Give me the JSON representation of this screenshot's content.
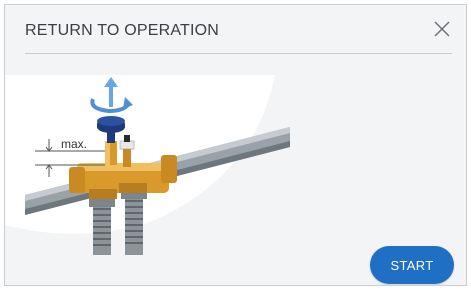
{
  "dialog": {
    "title": "RETURN TO OPERATION",
    "close_icon": "close-icon",
    "start_label": "START"
  },
  "illustration": {
    "measure_label": "max.",
    "rotate_icon": "rotate-arrow-icon"
  },
  "colors": {
    "accent": "#1f6fc4",
    "background": "#f2f4f6",
    "brass": "#d99a2b",
    "handwheel": "#1e3a7a",
    "arrow": "#6aa6e3",
    "pipe": "#8f979e"
  }
}
